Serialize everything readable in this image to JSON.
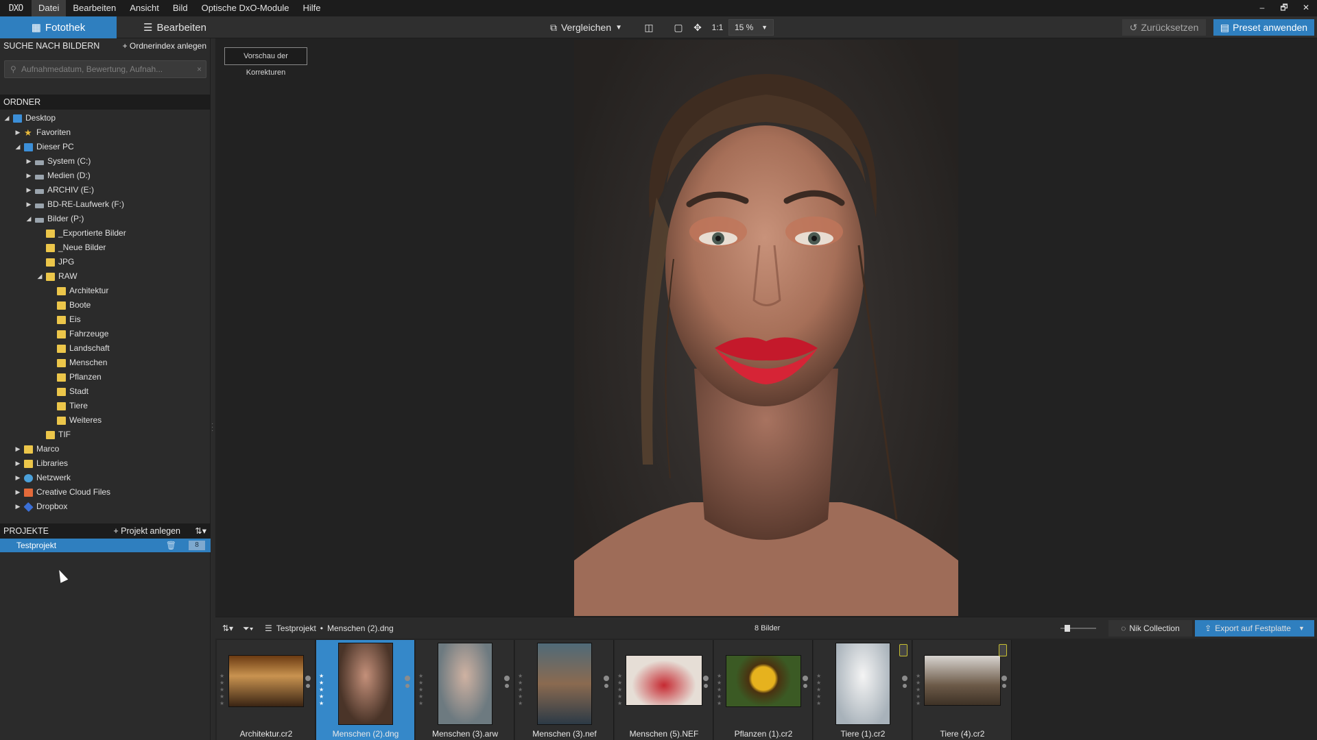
{
  "app": {
    "logo": "DXO"
  },
  "menu": {
    "items": [
      "Datei",
      "Bearbeiten",
      "Ansicht",
      "Bild",
      "Optische DxO-Module",
      "Hilfe"
    ],
    "active": "Datei"
  },
  "window_controls": [
    "‒",
    "🗗",
    "✕"
  ],
  "toolbar": {
    "tab_fotothek": "Fotothek",
    "tab_bearbeiten": "Bearbeiten",
    "compare": "Vergleichen",
    "one_to_one": "1:1",
    "zoom": "15 %",
    "reset": "Zurücksetzen",
    "preset": "Preset anwenden"
  },
  "left_panel": {
    "search_title": "SUCHE NACH BILDERN",
    "search_action": "+ Ordnerindex anlegen",
    "search_placeholder": "Aufnahmedatum, Bewertung, Aufnah...",
    "folders_title": "ORDNER",
    "tree": [
      {
        "label": "Desktop",
        "icon": "desktop-icon",
        "expanded": true
      },
      {
        "label": "Favoriten",
        "icon": "star-icon",
        "expanded": false
      },
      {
        "label": "Dieser PC",
        "icon": "pc-icon",
        "expanded": true
      },
      {
        "label": "System (C:)",
        "icon": "drive-icon",
        "expanded": false
      },
      {
        "label": "Medien (D:)",
        "icon": "drive-icon",
        "expanded": false
      },
      {
        "label": "ARCHIV (E:)",
        "icon": "drive-icon",
        "expanded": false
      },
      {
        "label": "BD-RE-Laufwerk (F:)",
        "icon": "disc-drive-icon",
        "expanded": false
      },
      {
        "label": "Bilder (P:)",
        "icon": "drive-icon",
        "expanded": true
      },
      {
        "label": "_Exportierte Bilder",
        "icon": "folder-icon"
      },
      {
        "label": "_Neue Bilder",
        "icon": "folder-icon"
      },
      {
        "label": "JPG",
        "icon": "folder-icon"
      },
      {
        "label": "RAW",
        "icon": "folder-icon",
        "expanded": true
      },
      {
        "label": "Architektur",
        "icon": "folder-icon"
      },
      {
        "label": "Boote",
        "icon": "folder-icon"
      },
      {
        "label": "Eis",
        "icon": "folder-icon"
      },
      {
        "label": "Fahrzeuge",
        "icon": "folder-icon"
      },
      {
        "label": "Landschaft",
        "icon": "folder-icon"
      },
      {
        "label": "Menschen",
        "icon": "folder-icon"
      },
      {
        "label": "Pflanzen",
        "icon": "folder-icon"
      },
      {
        "label": "Stadt",
        "icon": "folder-icon"
      },
      {
        "label": "Tiere",
        "icon": "folder-icon"
      },
      {
        "label": "Weiteres",
        "icon": "folder-icon"
      },
      {
        "label": "TIF",
        "icon": "folder-icon"
      },
      {
        "label": "Marco",
        "icon": "folder-icon",
        "expanded": false
      },
      {
        "label": "Libraries",
        "icon": "libraries-icon",
        "expanded": false
      },
      {
        "label": "Netzwerk",
        "icon": "network-icon",
        "expanded": false
      },
      {
        "label": "Creative Cloud Files",
        "icon": "creative-cloud-icon",
        "expanded": false
      },
      {
        "label": "Dropbox",
        "icon": "dropbox-icon",
        "expanded": false
      }
    ],
    "projects_title": "PROJEKTE",
    "projects_action": "+ Projekt anlegen",
    "projects": [
      {
        "label": "Testprojekt",
        "count": "8"
      }
    ]
  },
  "viewer": {
    "preview_label": "Vorschau der Korrekturen"
  },
  "strip_bar": {
    "breadcrumb_project": "Testprojekt",
    "breadcrumb_sep": "•",
    "breadcrumb_file": "Menschen (2).dng",
    "image_count": "8 Bilder",
    "nik": "Nik Collection",
    "export": "Export auf Festplatte"
  },
  "filmstrip": [
    {
      "label": "Architektur.cr2",
      "selected": false
    },
    {
      "label": "Menschen (2).dng",
      "selected": true
    },
    {
      "label": "Menschen (3).arw",
      "selected": false
    },
    {
      "label": "Menschen (3).nef",
      "selected": false
    },
    {
      "label": "Menschen (5).NEF",
      "selected": false
    },
    {
      "label": "Pflanzen (1).cr2",
      "selected": false
    },
    {
      "label": "Tiere (1).cr2",
      "selected": false
    },
    {
      "label": "Tiere (4).cr2",
      "selected": false
    }
  ],
  "colors": {
    "accent": "#2f7fbf",
    "background": "#2b2b2b",
    "viewer_bg": "#222222"
  }
}
